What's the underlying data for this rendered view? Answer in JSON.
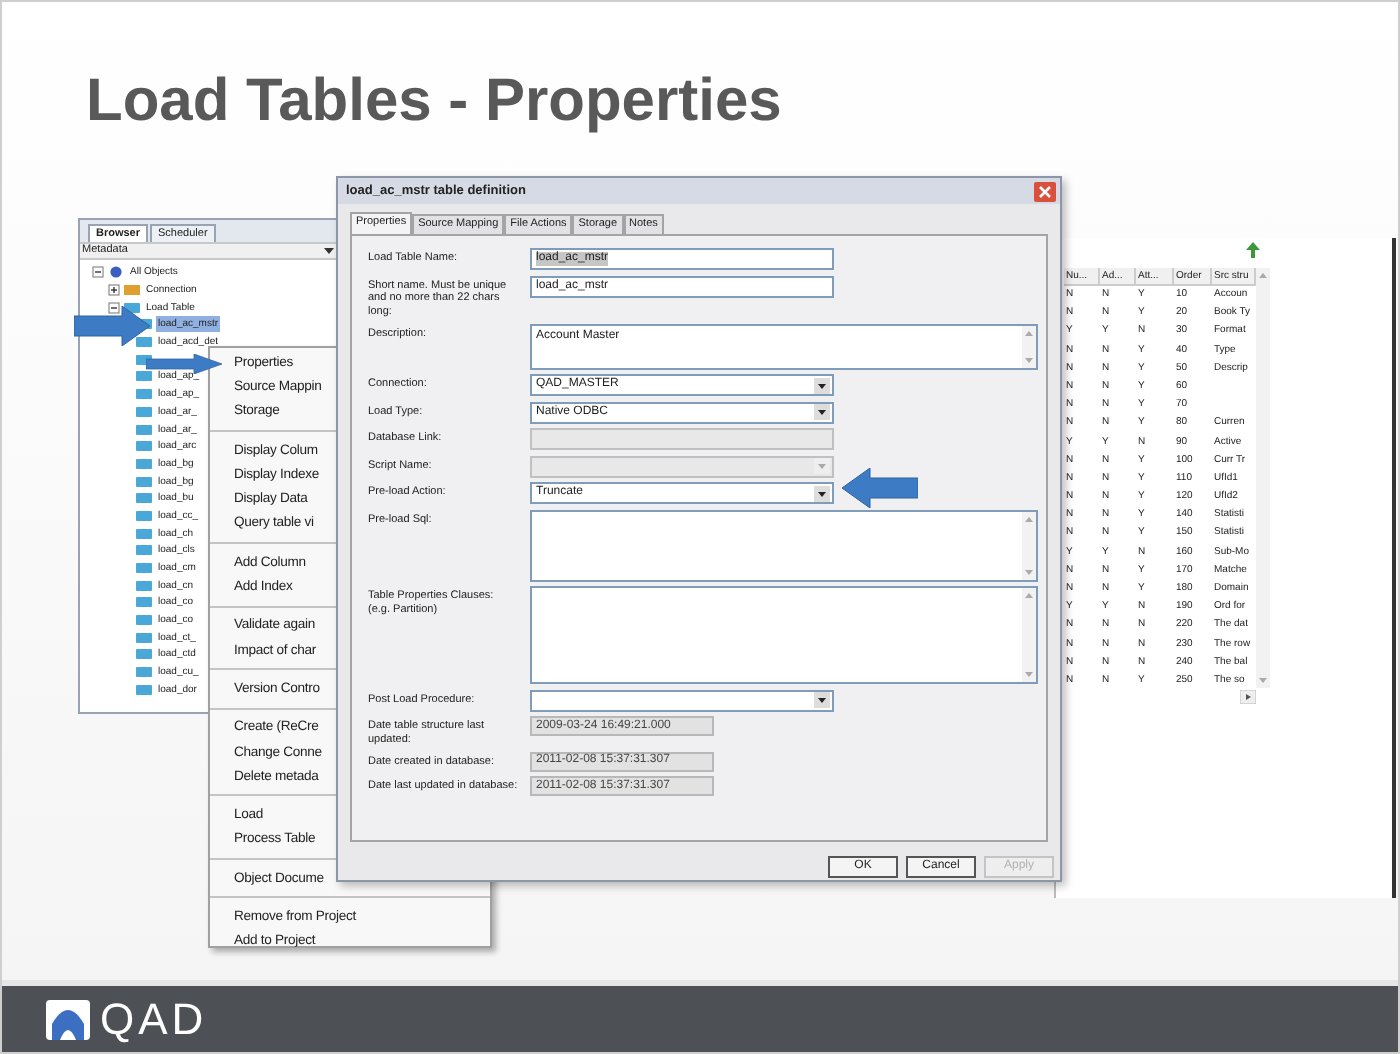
{
  "slide_title": "Load Tables - Properties",
  "browser": {
    "tabs": [
      {
        "label": "Browser",
        "selected": true
      },
      {
        "label": "Scheduler",
        "selected": false
      }
    ],
    "header": "Metadata",
    "tree": [
      {
        "label": "All Objects",
        "expanded": true,
        "children": [
          {
            "label": "Connection",
            "expanded": false
          },
          {
            "label": "Load Table",
            "expanded": true,
            "children": [
              {
                "label": "load_ac_mstr",
                "selected": true
              },
              {
                "label": "load_acd_det",
                "selected": false
              },
              {
                "selected": false
              },
              {
                "label": "load_ap_",
                "selected": false
              },
              {
                "label": "load_ap_",
                "selected": false
              },
              {
                "label": "load_ar_",
                "selected": false
              },
              {
                "label": "load_ar_",
                "selected": false
              },
              {
                "label": "load_arc",
                "selected": false
              },
              {
                "label": "load_bg",
                "selected": false
              },
              {
                "label": "load_bg",
                "selected": false
              },
              {
                "label": "load_bu",
                "selected": false
              },
              {
                "label": "load_cc_",
                "selected": false
              },
              {
                "label": "load_ch",
                "selected": false
              },
              {
                "label": "load_cls",
                "selected": false
              },
              {
                "label": "load_cm",
                "selected": false
              },
              {
                "label": "load_cn",
                "selected": false
              },
              {
                "label": "load_co",
                "selected": false
              },
              {
                "label": "load_co",
                "selected": false
              },
              {
                "label": "load_ct_",
                "selected": false
              },
              {
                "label": "load_ctd",
                "selected": false
              },
              {
                "label": "load_cu_",
                "selected": false
              },
              {
                "label": "load_dor",
                "selected": false
              }
            ]
          }
        ]
      }
    ]
  },
  "context_menu": {
    "groups": [
      {
        "items": [
          "Properties",
          "Source Mappin",
          "Storage"
        ]
      },
      {
        "items": [
          "Display Colum",
          "Display Indexe",
          "Display Data",
          "Query table vi"
        ]
      },
      {
        "items": [
          "Add Column",
          "Add Index"
        ]
      },
      {
        "items": [
          "Validate again",
          "Impact of char"
        ]
      },
      {
        "items": [
          "Version Contro"
        ]
      },
      {
        "items": [
          "Create (ReCre",
          "Change Conne",
          "Delete metada"
        ]
      },
      {
        "items": [
          "Load",
          "Process Table"
        ]
      },
      {
        "items": [
          "Object Docume"
        ]
      },
      {
        "items": [
          "Remove from Project",
          "Add to Project"
        ]
      }
    ]
  },
  "dialog": {
    "title": "load_ac_mstr table definition",
    "tabs": [
      {
        "label": "Properties",
        "selected": true
      },
      {
        "label": "Source Mapping",
        "selected": false
      },
      {
        "label": "File Actions",
        "selected": false
      },
      {
        "label": "Storage",
        "selected": false
      },
      {
        "label": "Notes",
        "selected": false
      }
    ],
    "fields": [
      {
        "kind": "text",
        "label": "Load Table Name:",
        "value": "load_ac_mstr",
        "disabled": false,
        "highlighted": true
      },
      {
        "kind": "text",
        "label": "Short name. Must be unique and no more than 22 chars long:",
        "value": "load_ac_mstr",
        "disabled": false,
        "highlighted": false
      },
      {
        "kind": "memo",
        "label": "Description:",
        "value": "Account Master",
        "disabled": false
      },
      {
        "kind": "select",
        "label": "Connection:",
        "value": "QAD_MASTER",
        "disabled": false
      },
      {
        "kind": "select",
        "label": "Load Type:",
        "value": "Native ODBC",
        "disabled": false
      },
      {
        "kind": "text",
        "label": "Database Link:",
        "disabled": true
      },
      {
        "kind": "select",
        "label": "Script Name:",
        "disabled": true
      },
      {
        "kind": "select",
        "label": "Pre-load Action:",
        "value": "Truncate",
        "disabled": false
      },
      {
        "kind": "textarea",
        "label": "Pre-load Sql:",
        "disabled": false
      },
      {
        "kind": "textarea",
        "label": "Table Properties Clauses:",
        "note": "(e.g. Partition)",
        "disabled": false
      },
      {
        "kind": "select",
        "label": "Post Load Procedure:",
        "disabled": false
      },
      {
        "kind": "readonly",
        "label": "Date table structure last updated:",
        "value": "2009-03-24 16:49:21.000"
      },
      {
        "kind": "readonly",
        "label": "Date created in database:",
        "value": "2011-02-08 15:37:31.307"
      },
      {
        "kind": "readonly",
        "label": "Date last updated in database:",
        "value": "2011-02-08 15:37:31.307"
      }
    ],
    "buttons": [
      {
        "label": "OK",
        "disabled": false
      },
      {
        "label": "Cancel",
        "disabled": false
      },
      {
        "label": "Apply",
        "disabled": true
      }
    ]
  },
  "columns_panel": {
    "columns": [
      "Nu...",
      "Ad...",
      "Att...",
      "Order",
      "Src stru"
    ],
    "rows": [
      [
        "N",
        "N",
        "Y",
        "10",
        "Accoun"
      ],
      [
        "N",
        "N",
        "Y",
        "20",
        "Book Ty"
      ],
      [
        "Y",
        "Y",
        "N",
        "30",
        "Format"
      ],
      [
        "N",
        "N",
        "Y",
        "40",
        "Type"
      ],
      [
        "N",
        "N",
        "Y",
        "50",
        "Descrip"
      ],
      [
        "N",
        "N",
        "Y",
        "60"
      ],
      [
        "N",
        "N",
        "Y",
        "70"
      ],
      [
        "N",
        "N",
        "Y",
        "80",
        "Curren"
      ],
      [
        "Y",
        "Y",
        "N",
        "90",
        "Active"
      ],
      [
        "N",
        "N",
        "Y",
        "100",
        "Curr Tr"
      ],
      [
        "N",
        "N",
        "Y",
        "110",
        "UfId1"
      ],
      [
        "N",
        "N",
        "Y",
        "120",
        "UfId2"
      ],
      [
        "N",
        "N",
        "Y",
        "140",
        "Statisti"
      ],
      [
        "N",
        "N",
        "Y",
        "150",
        "Statisti"
      ],
      [
        "Y",
        "Y",
        "N",
        "160",
        "Sub-Mo"
      ],
      [
        "N",
        "N",
        "Y",
        "170",
        "Matche"
      ],
      [
        "N",
        "N",
        "Y",
        "180",
        "Domain"
      ],
      [
        "Y",
        "Y",
        "N",
        "190",
        "Ord for"
      ],
      [
        "N",
        "N",
        "N",
        "220",
        "The dat"
      ],
      [
        "N",
        "N",
        "N",
        "230",
        "The row"
      ],
      [
        "N",
        "N",
        "N",
        "240",
        "The bal"
      ],
      [
        "N",
        "N",
        "Y",
        "250",
        "The so"
      ]
    ]
  },
  "footer": {
    "logo_text": "QAD"
  }
}
